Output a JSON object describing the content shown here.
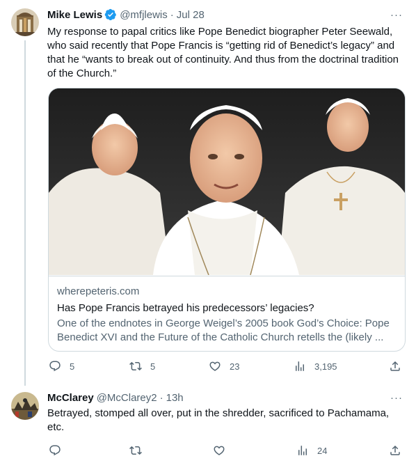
{
  "tweet1": {
    "author_name": "Mike Lewis",
    "handle": "@mfjlewis",
    "separator": "·",
    "time": "Jul 28",
    "more": "···",
    "text": "My response to papal critics like Pope Benedict biographer Peter Seewald, who said recently that Pope Francis is “getting rid of Benedict’s legacy” and that he “wants to break out of continuity. And thus from the doctrinal tradition of the Church.”",
    "card": {
      "domain": "wherepeteris.com",
      "title": "Has Pope Francis betrayed his predecessors’ legacies?",
      "description": "One of the endnotes in George Weigel’s 2005 book God’s Choice: Pope Benedict XVI and the Future of the Catholic Church retells the (likely ..."
    },
    "actions": {
      "replies": "5",
      "retweets": "5",
      "likes": "23",
      "views": "3,195"
    }
  },
  "tweet2": {
    "author_name": "McClarey",
    "handle": "@McClarey2",
    "separator": "·",
    "time": "13h",
    "more": "···",
    "text": "Betrayed, stomped all over, put in the shredder, sacrificed to Pachamama, etc.",
    "actions": {
      "views": "24"
    }
  },
  "colors": {
    "text_primary": "#0f1419",
    "text_secondary": "#536471",
    "border": "#cfd9de",
    "verified": "#1d9bf0"
  },
  "icons": [
    "verified-badge-icon",
    "more-icon",
    "reply-icon",
    "retweet-icon",
    "like-icon",
    "views-icon",
    "share-icon"
  ]
}
